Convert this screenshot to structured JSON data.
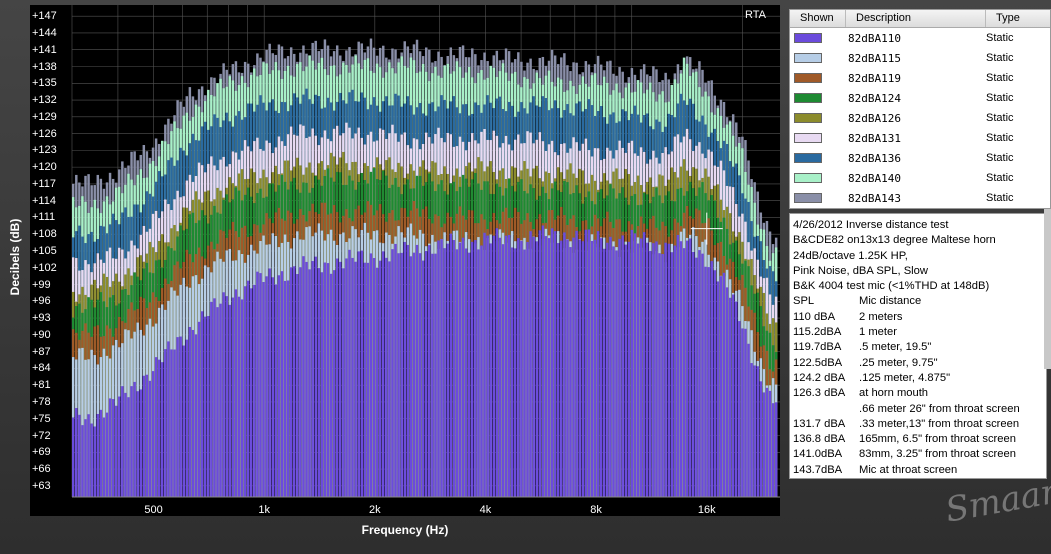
{
  "app": {
    "panel_title": "RTA",
    "logo": "Smaart"
  },
  "legend": {
    "headers": [
      "Shown",
      "Description",
      "Type"
    ],
    "rows": [
      {
        "color": "#6b4bdc",
        "description": "82dBA110",
        "type": "Static"
      },
      {
        "color": "#b6cde6",
        "description": "82dBA115",
        "type": "Static"
      },
      {
        "color": "#a05a28",
        "description": "82dBA119",
        "type": "Static"
      },
      {
        "color": "#1e8a32",
        "description": "82dBA124",
        "type": "Static"
      },
      {
        "color": "#8c8c2c",
        "description": "82dBA126",
        "type": "Static"
      },
      {
        "color": "#e8daf2",
        "description": "82dBA131",
        "type": "Static"
      },
      {
        "color": "#2a6aa0",
        "description": "82dBA136",
        "type": "Static"
      },
      {
        "color": "#a8f0c8",
        "description": "82dBA140",
        "type": "Static"
      },
      {
        "color": "#8a8fa8",
        "description": "82dBA143",
        "type": "Static"
      }
    ]
  },
  "notes": {
    "lines": [
      "4/26/2012 Inverse distance test",
      "B&CDE82 on13x13 degree Maltese horn",
      "24dB/octave 1.25K HP,",
      "Pink Noise,  dBA SPL, Slow",
      "B&K 4004 test mic (<1%THD at 148dB)"
    ],
    "table": [
      {
        "spl": "SPL",
        "distance": "Mic distance"
      },
      {
        "spl": "110   dBA",
        "distance": "2 meters"
      },
      {
        "spl": "115.2dBA",
        "distance": "1 meter"
      },
      {
        "spl": "119.7dBA",
        "distance": ".5 meter, 19.5\""
      },
      {
        "spl": "122.5dBA",
        "distance": ".25 meter, 9.75\""
      },
      {
        "spl": "124.2 dBA",
        "distance": ".125 meter, 4.875\""
      },
      {
        "spl": "126.3 dBA",
        "distance": "at horn mouth"
      },
      {
        "spl": "",
        "distance": ".66 meter 26\" from throat screen"
      },
      {
        "spl": "131.7 dBA",
        "distance": ".33 meter,13\" from throat screen"
      },
      {
        "spl": "136.8 dBA",
        "distance": "165mm, 6.5\" from throat screen"
      },
      {
        "spl": "141.0dBA",
        "distance": "83mm, 3.25\" from throat screen"
      },
      {
        "spl": "143.7dBA",
        "distance": "Mic at throat screen"
      }
    ]
  },
  "chart_data": {
    "type": "bar",
    "xlabel": "Frequency (Hz)",
    "ylabel": "Decibels (dB)",
    "ylim": [
      61,
      149
    ],
    "xlim_hz": [
      300,
      25000
    ],
    "x_scale": "log",
    "yticks": [
      "+63",
      "+66",
      "+69",
      "+72",
      "+75",
      "+78",
      "+81",
      "+84",
      "+87",
      "+90",
      "+93",
      "+96",
      "+99",
      "+102",
      "+105",
      "+108",
      "+111",
      "+114",
      "+117",
      "+120",
      "+123",
      "+126",
      "+129",
      "+132",
      "+135",
      "+138",
      "+141",
      "+144",
      "+147"
    ],
    "xticks": [
      {
        "label": "500",
        "hz": 500
      },
      {
        "label": "1k",
        "hz": 1000
      },
      {
        "label": "2k",
        "hz": 2000
      },
      {
        "label": "4k",
        "hz": 4000
      },
      {
        "label": "8k",
        "hz": 8000
      },
      {
        "label": "16k",
        "hz": 16000
      }
    ],
    "grid": true,
    "x": [
      335,
      400,
      500,
      630,
      800,
      1000,
      1250,
      1600,
      2000,
      2500,
      3150,
      4000,
      5000,
      6300,
      8000,
      10000,
      12500,
      14000,
      16000,
      18000,
      20000,
      22000,
      24000
    ],
    "series": [
      {
        "name": "82dBA143",
        "values": [
          117,
          119,
          124,
          133,
          137,
          140,
          141,
          141,
          141,
          141,
          140,
          140,
          139,
          139,
          138,
          137,
          136,
          139,
          136,
          131,
          125,
          115,
          108
        ]
      },
      {
        "name": "82dBA140",
        "values": [
          113,
          115,
          121,
          130,
          135,
          137,
          138,
          138,
          138,
          138,
          137,
          137,
          136,
          135,
          135,
          134,
          133,
          138,
          133,
          128,
          122,
          112,
          104
        ]
      },
      {
        "name": "82dBA136",
        "values": [
          108,
          110,
          116,
          125,
          129,
          131,
          132,
          132,
          132,
          131,
          131,
          131,
          131,
          131,
          130,
          129,
          128,
          132,
          128,
          123,
          117,
          108,
          100
        ]
      },
      {
        "name": "82dBA131",
        "values": [
          103,
          104,
          110,
          118,
          122,
          124,
          126,
          126,
          126,
          125,
          125,
          125,
          125,
          124,
          123,
          123,
          122,
          126,
          123,
          118,
          112,
          103,
          96
        ]
      },
      {
        "name": "82dBA126",
        "values": [
          98,
          100,
          105,
          113,
          117,
          119,
          120,
          121,
          120,
          120,
          119,
          120,
          119,
          119,
          118,
          118,
          117,
          121,
          118,
          113,
          107,
          99,
          92
        ]
      },
      {
        "name": "82dBA124",
        "values": [
          95,
          97,
          102,
          110,
          114,
          116,
          117,
          118,
          118,
          117,
          117,
          117,
          116,
          116,
          115,
          115,
          114,
          117,
          115,
          110,
          104,
          96,
          89
        ]
      },
      {
        "name": "82dBA119",
        "values": [
          90,
          92,
          97,
          104,
          108,
          110,
          112,
          112,
          112,
          112,
          111,
          111,
          111,
          111,
          110,
          110,
          109,
          112,
          110,
          105,
          99,
          91,
          85
        ]
      },
      {
        "name": "82dBA115",
        "values": [
          86,
          88,
          93,
          100,
          104,
          106,
          108,
          108,
          108,
          108,
          107,
          107,
          107,
          107,
          106,
          106,
          105,
          108,
          106,
          101,
          95,
          87,
          81
        ]
      },
      {
        "name": "82dBA110",
        "values": [
          75,
          78,
          84,
          91,
          97,
          100,
          102,
          103,
          104,
          105,
          106,
          107,
          107,
          108,
          107,
          107,
          106,
          106,
          104,
          99,
          92,
          84,
          78
        ]
      }
    ],
    "annotations": [
      {
        "type": "crosshair",
        "hz": 16000,
        "db": 109
      }
    ]
  }
}
